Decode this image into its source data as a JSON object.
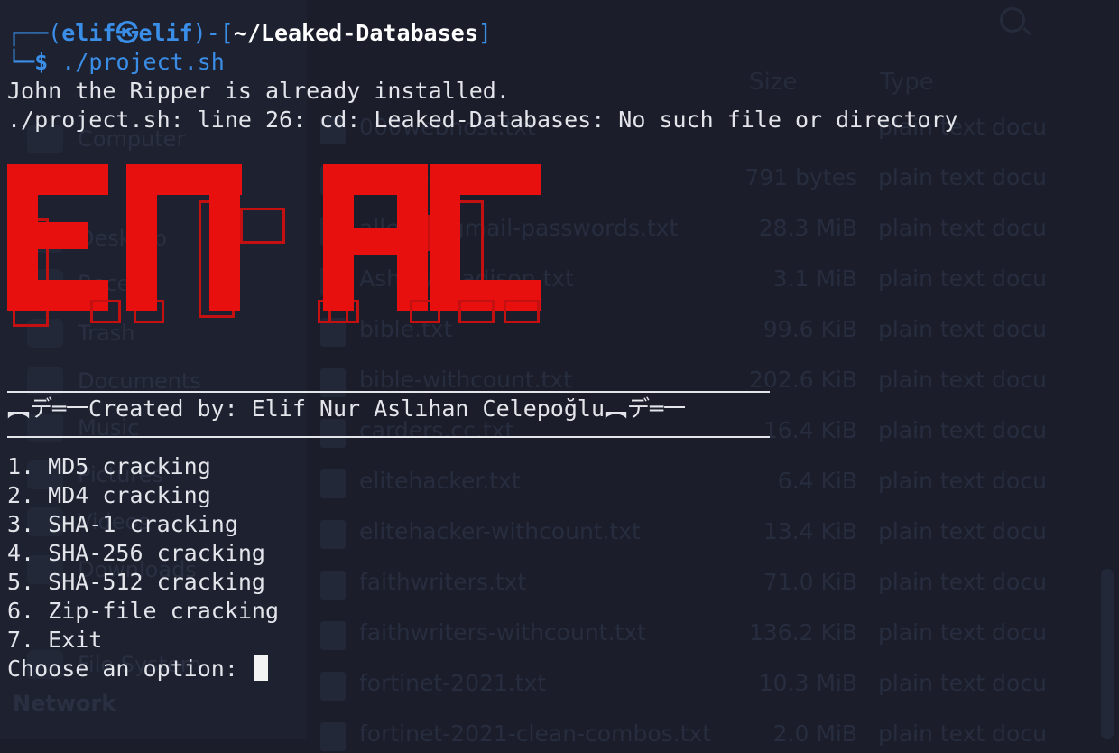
{
  "background_window": {
    "sidebar_items": [
      "Computer",
      "Desktop",
      "Recent",
      "Trash",
      "Documents",
      "Music",
      "Pictures",
      "Videos",
      "Downloads",
      "File System"
    ],
    "sidebar_heading": "Network",
    "column_headers": {
      "name": "Name",
      "size": "Size",
      "type": "Type"
    },
    "files": [
      {
        "name": "000webhost.txt",
        "size": "",
        "type": "plain text docu"
      },
      {
        "name": "adobe100.txt",
        "size": "791 bytes",
        "type": "plain text docu"
      },
      {
        "name": "alleged-gmail-passwords.txt",
        "size": "28.3 MiB",
        "type": "plain text docu"
      },
      {
        "name": "Ashley-Madison.txt",
        "size": "3.1 MiB",
        "type": "plain text docu"
      },
      {
        "name": "bible.txt",
        "size": "99.6 KiB",
        "type": "plain text docu"
      },
      {
        "name": "bible-withcount.txt",
        "size": "202.6 KiB",
        "type": "plain text docu"
      },
      {
        "name": "carders.cc.txt",
        "size": "16.4 KiB",
        "type": "plain text docu"
      },
      {
        "name": "elitehacker.txt",
        "size": "6.4 KiB",
        "type": "plain text docu"
      },
      {
        "name": "elitehacker-withcount.txt",
        "size": "13.4 KiB",
        "type": "plain text docu"
      },
      {
        "name": "faithwriters.txt",
        "size": "71.0 KiB",
        "type": "plain text docu"
      },
      {
        "name": "faithwriters-withcount.txt",
        "size": "136.2 KiB",
        "type": "plain text docu"
      },
      {
        "name": "fortinet-2021.txt",
        "size": "10.3 MiB",
        "type": "plain text docu"
      },
      {
        "name": "fortinet-2021-clean-combos.txt",
        "size": "2.0 MiB",
        "type": "plain text docu"
      }
    ]
  },
  "terminal": {
    "prompt": {
      "frame_top_left": "┌──(",
      "user": "elif",
      "skull": "㉿",
      "host": "elif",
      "frame_mid": ")-[",
      "path": "~/Leaked-Databases",
      "frame_close": "]",
      "frame_bottom_left": "└─",
      "dollar": "$",
      "command": "./project.sh"
    },
    "output_lines": [
      "John the Ripper is already installed.",
      "./project.sh: line 26: cd: Leaked-Databases: No such file or directory"
    ],
    "banner_text": "ENAC",
    "credit_line": "︻デ═一Created by: Elif Nur Aslıhan Celepoğlu︻デ═一",
    "menu_items": [
      "1. MD5 cracking",
      "2. MD4 cracking",
      "3. SHA-1 cracking",
      "4. SHA-256 cracking",
      "5. SHA-512 cracking",
      "6. Zip-file cracking",
      "7. Exit"
    ],
    "input_prompt": "Choose an option: "
  }
}
